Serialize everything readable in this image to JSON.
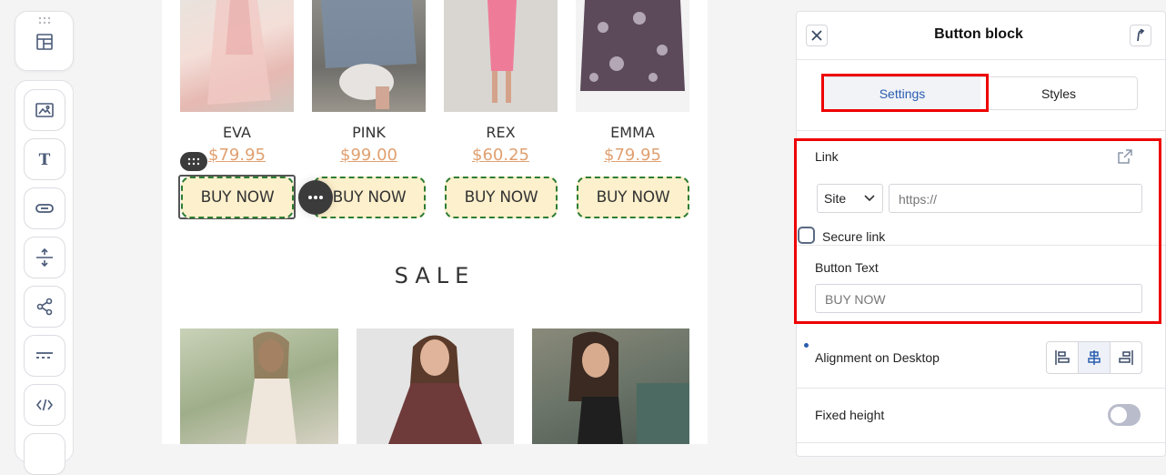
{
  "products_top": [
    {
      "name": "EVA",
      "price": "$79.95",
      "button": "BUY NOW"
    },
    {
      "name": "PINK",
      "price": "$99.00",
      "button": "BUY NOW"
    },
    {
      "name": "REX",
      "price": "$60.25",
      "button": "BUY NOW"
    },
    {
      "name": "EMMA",
      "price": "$79.95",
      "button": "BUY NOW"
    }
  ],
  "sale_heading": "SALE",
  "panel": {
    "title": "Button block",
    "tabs": [
      {
        "label": "Settings",
        "active": true
      },
      {
        "label": "Styles",
        "active": false
      }
    ],
    "link_label": "Link",
    "link_type": "Site",
    "link_placeholder": "https://",
    "secure_link_label": "Secure link",
    "button_text_label": "Button Text",
    "button_text_placeholder": "BUY NOW",
    "alignment_label": "Alignment on Desktop",
    "fixed_height_label": "Fixed height"
  },
  "colors": {
    "accent_blue": "#2a5db0",
    "price_orange": "#e0a070",
    "button_bg": "#fdf0cc",
    "button_border": "#2e7d32",
    "highlight_red": "#ee0000"
  },
  "toolbar_icons": [
    "layout-icon",
    "image-icon",
    "text-icon",
    "button-icon",
    "divider-icon",
    "share-icon",
    "spacer-icon",
    "code-icon"
  ]
}
